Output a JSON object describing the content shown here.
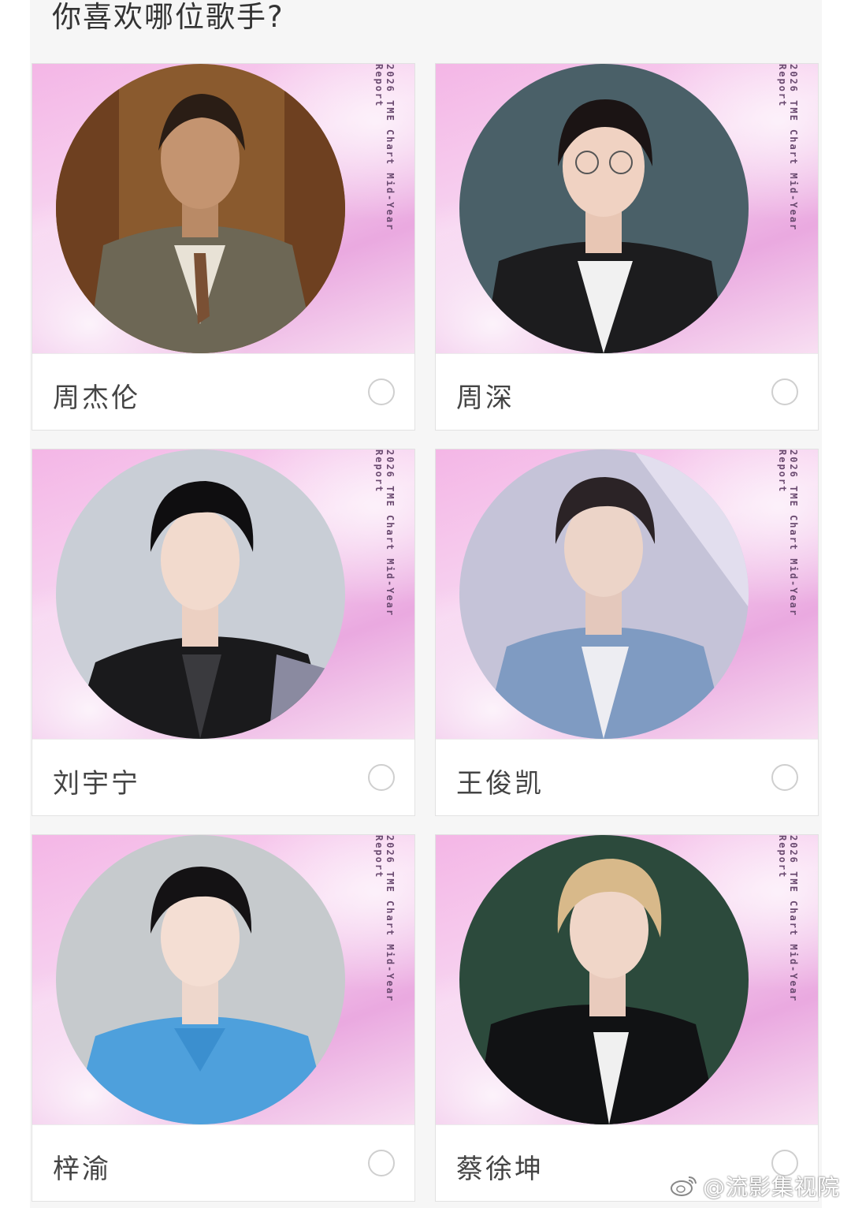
{
  "survey": {
    "question": "你喜欢哪位歌手?",
    "report_label": "2026 TME Chart Mid-Year Report",
    "options": [
      {
        "name": "周杰伦"
      },
      {
        "name": "周深"
      },
      {
        "name": "刘宇宁"
      },
      {
        "name": "王俊凯"
      },
      {
        "name": "梓渝"
      },
      {
        "name": "蔡徐坤"
      }
    ]
  },
  "watermark": {
    "text": "@流影集视院"
  },
  "colors": {
    "card_bg": "#ffffff",
    "panel_bg": "#f6f6f6",
    "pink_accent": "#f4b6e6"
  }
}
